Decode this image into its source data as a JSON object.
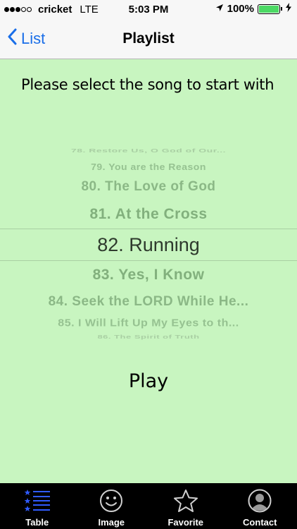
{
  "status_bar": {
    "carrier": "cricket",
    "network": "LTE",
    "time": "5:03 PM",
    "battery_percent_text": "100%",
    "battery_level": 1.0,
    "signal_bars_filled": 3,
    "signal_bars_total": 5
  },
  "nav": {
    "back_label": "List",
    "title": "Playlist"
  },
  "prompt": "Please select the song to start with",
  "picker": {
    "items": [
      "78. Restore Us, O God of Our...",
      "79. You are the Reason",
      "80. The Love of God",
      "81. At the Cross",
      "82. Running",
      "83. Yes, I Know",
      "84. Seek the LORD While He...",
      "85. I Will Lift Up My Eyes to th...",
      "86. The Spirit of Truth"
    ],
    "selected_index": 4
  },
  "play_label": "Play",
  "tabs": [
    {
      "label": "Table",
      "icon": "list-icon"
    },
    {
      "label": "Image",
      "icon": "smiley-icon"
    },
    {
      "label": "Favorite",
      "icon": "star-icon"
    },
    {
      "label": "Contact",
      "icon": "person-icon"
    }
  ],
  "colors": {
    "background": "#c8f5c0",
    "accent": "#1a6ee8",
    "tab_bar": "#000000",
    "battery": "#4cd964"
  }
}
